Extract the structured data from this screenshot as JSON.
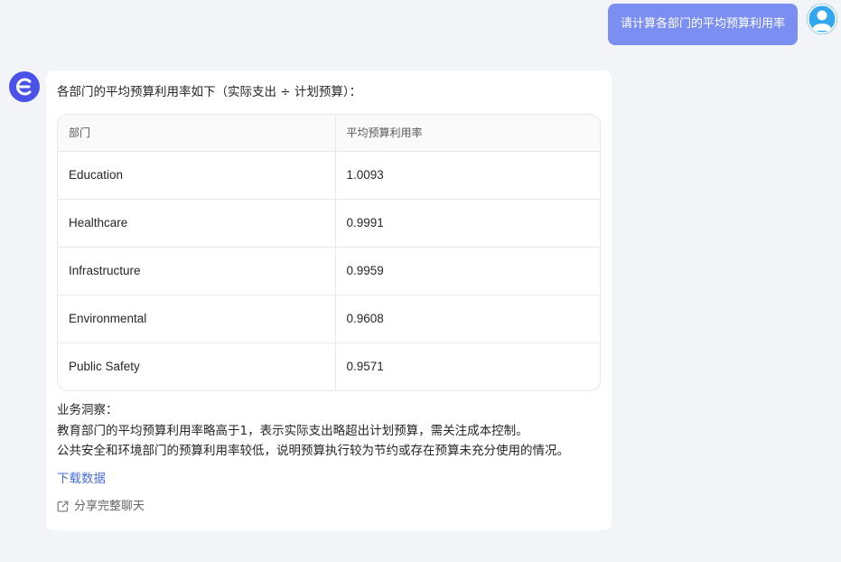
{
  "user_message": {
    "text": "请计算各部门的平均预算利用率",
    "avatar_icon": "user-avatar-icon"
  },
  "assistant": {
    "avatar_icon": "assistant-logo-icon",
    "intro": "各部门的平均预算利用率如下（实际支出 ÷ 计划预算）：",
    "table": {
      "headers": [
        "部门",
        "平均预算利用率"
      ],
      "rows": [
        {
          "dept": "Education",
          "rate": "1.0093"
        },
        {
          "dept": "Healthcare",
          "rate": "0.9991"
        },
        {
          "dept": "Infrastructure",
          "rate": "0.9959"
        },
        {
          "dept": "Environmental",
          "rate": "0.9608"
        },
        {
          "dept": "Public Safety",
          "rate": "0.9571"
        }
      ]
    },
    "insights": {
      "title": "业务洞察：",
      "lines": [
        "教育部门的平均预算利用率略高于1，表示实际支出略超出计划预算，需关注成本控制。",
        "公共安全和环境部门的预算利用率较低，说明预算执行较为节约或存在预算未充分使用的情况。"
      ]
    },
    "download_label": "下载数据",
    "share_label": "分享完整聊天",
    "share_icon": "external-link-icon"
  },
  "colors": {
    "background": "#f3f4f8",
    "user_bubble": "#7b8ff3",
    "user_avatar": "#33a6f0",
    "assistant_avatar": "#4a52e8",
    "link": "#4a6ee0"
  }
}
